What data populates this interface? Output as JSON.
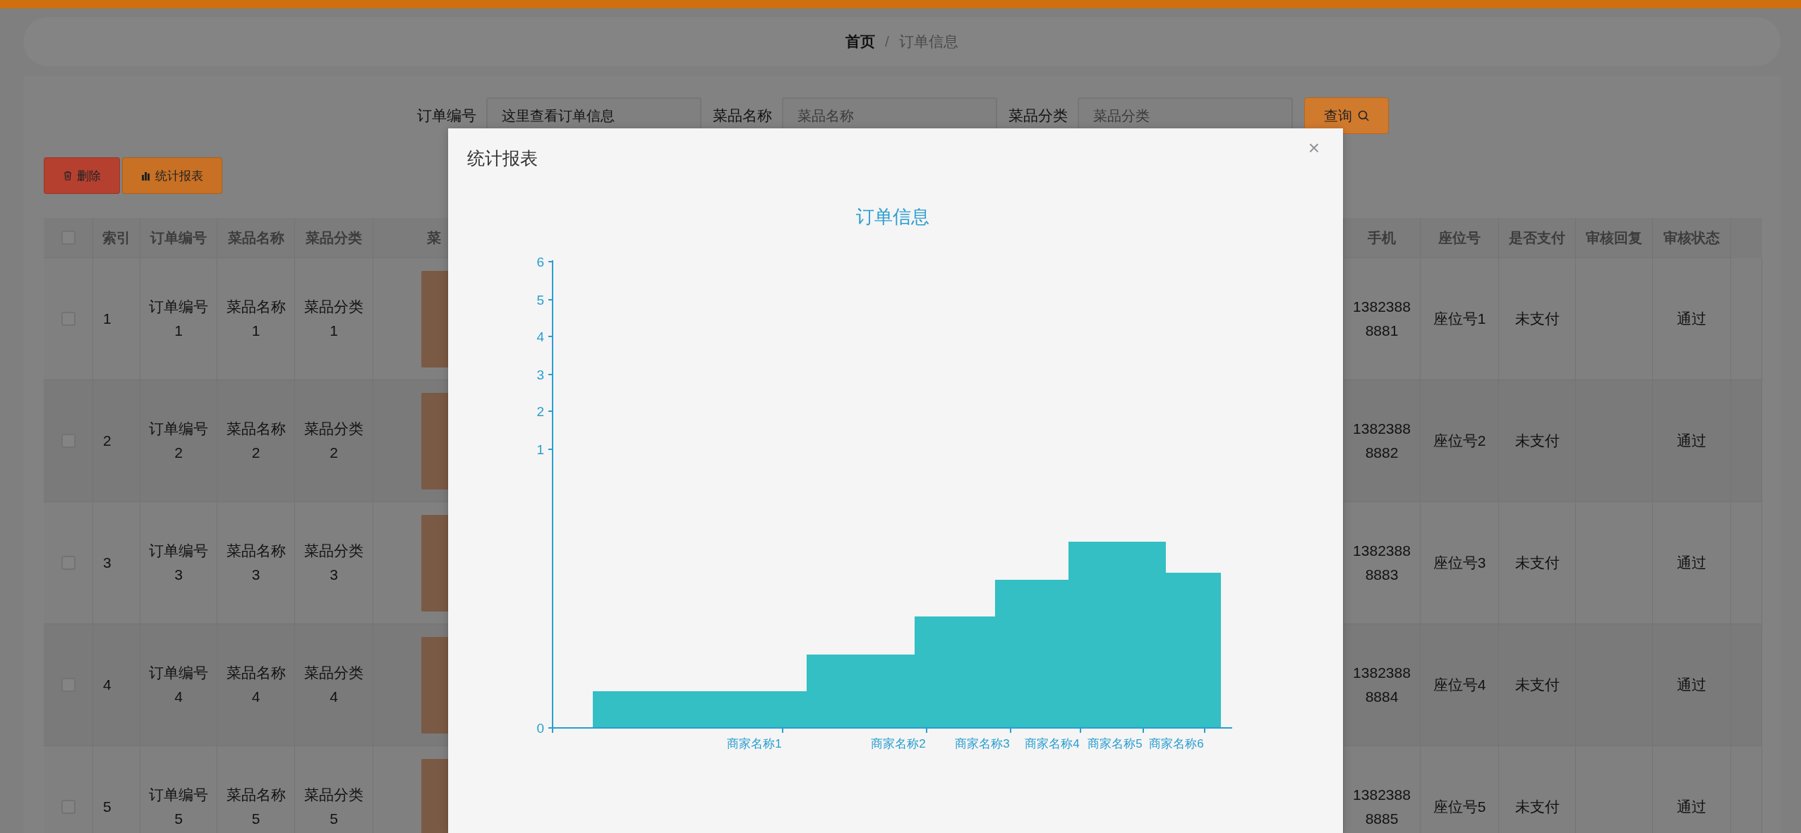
{
  "breadcrumb": [
    {
      "label": "首页",
      "current": false
    },
    {
      "label": "订单信息",
      "current": true
    }
  ],
  "breadcrumb_separator": "/",
  "search": {
    "fields": [
      {
        "label": "订单编号",
        "value": "这里查看订单信息"
      },
      {
        "label": "菜品名称",
        "placeholder": "菜品名称"
      },
      {
        "label": "菜品分类",
        "placeholder": "菜品分类"
      }
    ],
    "button": "查询"
  },
  "actions": [
    {
      "kind": "delete",
      "label": "删除"
    },
    {
      "kind": "report",
      "label": "统计报表"
    }
  ],
  "table": {
    "select_all_checked": false,
    "columns": [
      "索引",
      "订单编号",
      "菜品名称",
      "菜品分类",
      "菜",
      "手机",
      "座位号",
      "是否支付",
      "审核回复",
      "审核状态"
    ],
    "rows": [
      {
        "checked": false,
        "index": "1",
        "order_no": "订单编号1",
        "dish_name": "菜品名称1",
        "dish_category": "菜品分类1",
        "phone": "13823888881",
        "seat": "座位号1",
        "paid": "未支付",
        "review_status": "通过"
      },
      {
        "checked": false,
        "index": "2",
        "order_no": "订单编号2",
        "dish_name": "菜品名称2",
        "dish_category": "菜品分类2",
        "phone": "13823888882",
        "seat": "座位号2",
        "paid": "未支付",
        "review_status": "通过"
      },
      {
        "checked": false,
        "index": "3",
        "order_no": "订单编号3",
        "dish_name": "菜品名称3",
        "dish_category": "菜品分类3",
        "phone": "13823888883",
        "seat": "座位号3",
        "paid": "未支付",
        "review_status": "通过"
      },
      {
        "checked": false,
        "index": "4",
        "order_no": "订单编号4",
        "dish_name": "菜品名称4",
        "dish_category": "菜品分类4",
        "phone": "13823888884",
        "seat": "座位号4",
        "paid": "未支付",
        "review_status": "通过"
      },
      {
        "checked": false,
        "index": "5",
        "order_no": "订单编号5",
        "dish_name": "菜品名称5",
        "dish_category": "菜品分类5",
        "phone": "13823888885",
        "seat": "座位号5",
        "paid": "未支付",
        "review_status": "通过"
      }
    ]
  },
  "modal": {
    "title": "统计报表",
    "close": "×",
    "chart": {
      "title": "订单信息",
      "y_axis_labels": [
        "6",
        "5",
        "4",
        "3",
        "2",
        "1",
        "0"
      ],
      "x_axis_labels": [
        "商家名称1",
        "商家名称2",
        "商家名称3",
        "商家名称4",
        "商家名称5",
        "商家名称6"
      ]
    }
  }
}
